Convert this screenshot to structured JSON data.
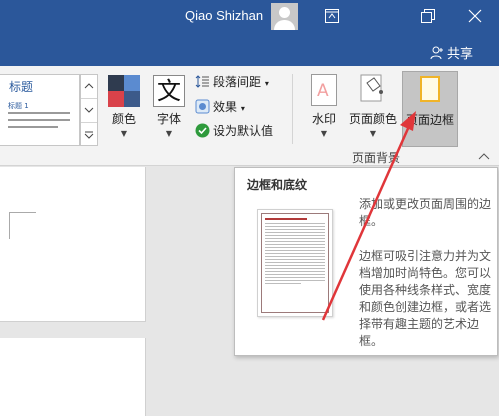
{
  "titlebar": {
    "user_name": "Qiao Shizhan",
    "share_label": "共享"
  },
  "ribbon": {
    "style_gallery": {
      "title_text": "标题",
      "subtitle_text": "标题 1"
    },
    "colors_label": "颜色",
    "fonts_label": "字体",
    "paragraph_spacing_label": "段落间距",
    "effects_label": "效果",
    "set_default_label": "设为默认值",
    "watermark_label": "水印",
    "page_color_label": "页面颜色",
    "page_borders_label": "页面边框",
    "group_label": "页面背景"
  },
  "tooltip": {
    "title": "边框和底纹",
    "para1": "添加或更改页面周围的边框。",
    "para2": "边框可吸引注意力并为文档增加时尚特色。您可以使用各种线条样式、宽度和颜色创建边框，或者选择带有趣主题的艺术边框。"
  },
  "colors": {
    "titlebar_bg": "#2b579a",
    "arrow": "#e0363a",
    "page_borders_highlight": "#c5c5c5"
  },
  "icons": [
    "avatar",
    "ribbon-display-options-icon",
    "restore-icon",
    "close-icon",
    "share-person-icon",
    "gallery-up-icon",
    "gallery-down-icon",
    "gallery-more-icon",
    "colors-icon",
    "fonts-icon",
    "paragraph-spacing-icon",
    "effects-icon",
    "checkmark-icon",
    "watermark-icon",
    "page-color-icon",
    "page-borders-icon",
    "collapse-ribbon-icon"
  ]
}
